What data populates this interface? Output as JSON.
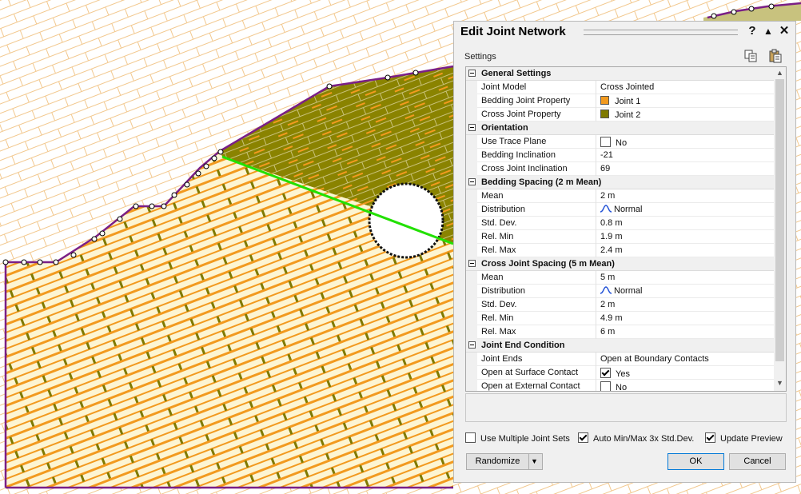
{
  "window": {
    "title": "Edit Joint Network",
    "help_label": "?",
    "collapse_label": "▲",
    "close_label": "✕"
  },
  "settings_label": "Settings",
  "toolbar_icons": [
    "copy-icon",
    "paste-icon"
  ],
  "colors": {
    "joint1": "#f29a1f",
    "joint2": "#7f7a00",
    "panel_bg": "#f0f0f0",
    "boundary": "#7a1f86",
    "highlight": "#22e000",
    "material_light": "#fdf5d2"
  },
  "general": {
    "header": "General Settings",
    "joint_model": {
      "label": "Joint Model",
      "value": "Cross Jointed"
    },
    "bedding_prop": {
      "label": "Bedding Joint Property",
      "value": "Joint 1"
    },
    "cross_prop": {
      "label": "Cross Joint Property",
      "value": "Joint 2"
    }
  },
  "orientation": {
    "header": "Orientation",
    "trace": {
      "label": "Use Trace Plane",
      "value": "No",
      "checked": false
    },
    "bed_incl": {
      "label": "Bedding Inclination",
      "value": "-21"
    },
    "cross_incl": {
      "label": "Cross Joint Inclination",
      "value": "69"
    }
  },
  "bedding_spacing": {
    "header": "Bedding Spacing   (2 m  Mean)",
    "mean": {
      "label": "Mean",
      "value": "2 m"
    },
    "dist": {
      "label": "Distribution",
      "value": "Normal"
    },
    "std": {
      "label": "Std. Dev.",
      "value": "0.8 m"
    },
    "min": {
      "label": "Rel. Min",
      "value": "1.9 m"
    },
    "max": {
      "label": "Rel. Max",
      "value": "2.4 m"
    }
  },
  "cross_spacing": {
    "header": "Cross Joint Spacing   (5 m  Mean)",
    "mean": {
      "label": "Mean",
      "value": "5 m"
    },
    "dist": {
      "label": "Distribution",
      "value": "Normal"
    },
    "std": {
      "label": "Std. Dev.",
      "value": "2 m"
    },
    "min": {
      "label": "Rel. Min",
      "value": "4.9 m"
    },
    "max": {
      "label": "Rel. Max",
      "value": "6 m"
    }
  },
  "end_condition": {
    "header": "Joint End Condition",
    "ends": {
      "label": "Joint Ends",
      "value": "Open at Boundary Contacts"
    },
    "surface": {
      "label": "Open at Surface Contact",
      "value": "Yes",
      "checked": true
    },
    "external": {
      "label": "Open at External Contact",
      "value": "No",
      "checked": false
    }
  },
  "options": {
    "multiple": {
      "label": "Use Multiple Joint Sets",
      "checked": false
    },
    "auto": {
      "label": "Auto Min/Max 3x Std.Dev.",
      "checked": true
    },
    "preview": {
      "label": "Update Preview",
      "checked": true
    }
  },
  "buttons": {
    "randomize": "Randomize",
    "ok": "OK",
    "cancel": "Cancel"
  }
}
